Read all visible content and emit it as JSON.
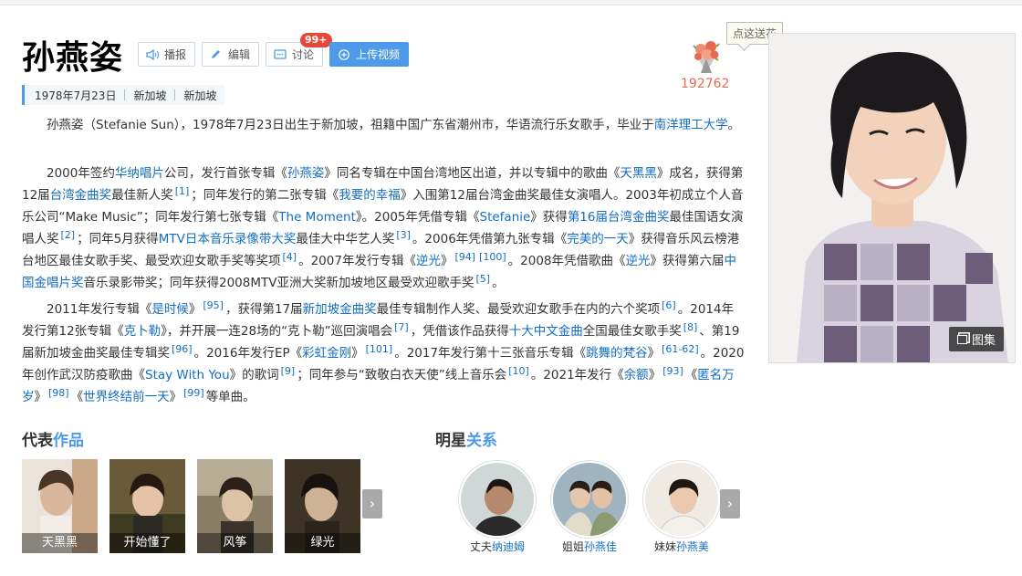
{
  "page": {
    "title": "孙燕姿",
    "actions": {
      "broadcast": "播报",
      "edit": "编辑",
      "discuss": "讨论",
      "discuss_badge": "99+",
      "upload": "上传视频"
    },
    "basic_info": [
      "1978年7月23日",
      "新加坡",
      "新加坡"
    ],
    "flower": {
      "tip": "点这送花",
      "count": "192762"
    },
    "gallery_label": "图集"
  },
  "summary": [
    [
      {
        "t": "孙燕姿（Stefanie Sun），1978年7月23日出生于新加坡，祖籍中国广东省潮州市，华语流行乐女歌手，毕业于"
      },
      {
        "a": "南洋理工大学"
      },
      {
        "t": "。"
      }
    ],
    [
      {
        "t": "2000年签约"
      },
      {
        "a": "华纳唱片"
      },
      {
        "t": "公司，发行首张专辑《"
      },
      {
        "a": "孙燕姿"
      },
      {
        "t": "》同名专辑在中国台湾地区出道，并以专辑中的歌曲《"
      },
      {
        "a": "天黑黑"
      },
      {
        "t": "》成名，获得第12届"
      },
      {
        "a": "台湾金曲奖"
      },
      {
        "t": "最佳新人奖"
      },
      {
        "s": "[1]"
      },
      {
        "t": "；同年发行的第二张专辑《"
      },
      {
        "a": "我要的幸福"
      },
      {
        "t": "》入围第12届台湾金曲奖最佳女演唱人。2003年初成立个人音乐公司“Make Music”；同年发行第七张专辑《"
      },
      {
        "a": "The Moment"
      },
      {
        "t": "》。2005年凭借专辑《"
      },
      {
        "a": "Stefanie"
      },
      {
        "t": "》获得"
      },
      {
        "a": "第16届台湾金曲奖"
      },
      {
        "t": "最佳国语女演唱人奖"
      },
      {
        "s": "[2]"
      },
      {
        "t": "；同年5月获得"
      },
      {
        "a": "MTV日本音乐录像带大奖"
      },
      {
        "t": "最佳大中华艺人奖"
      },
      {
        "s": "[3]"
      },
      {
        "t": "。2006年凭借第九张专辑《"
      },
      {
        "a": "完美的一天"
      },
      {
        "t": "》获得音乐风云榜港台地区最佳女歌手奖、最受欢迎女歌手奖等奖项"
      },
      {
        "s": "[4]"
      },
      {
        "t": "。2007年发行专辑《"
      },
      {
        "a": "逆光"
      },
      {
        "t": "》"
      },
      {
        "s": "[94]"
      },
      {
        "s": "[100]"
      },
      {
        "t": "。2008年凭借歌曲《"
      },
      {
        "a": "逆光"
      },
      {
        "t": "》获得第六届"
      },
      {
        "a": "中国金唱片奖"
      },
      {
        "t": "音乐录影带奖；同年获得2008MTV亚洲大奖新加坡地区最受欢迎歌手奖"
      },
      {
        "s": "[5]"
      },
      {
        "t": "。"
      }
    ],
    [
      {
        "t": "2011年发行专辑《"
      },
      {
        "a": "是时候"
      },
      {
        "t": "》"
      },
      {
        "s": "[95]"
      },
      {
        "t": "，获得第17届"
      },
      {
        "a": "新加坡金曲奖"
      },
      {
        "t": "最佳专辑制作人奖、最受欢迎女歌手在内的六个奖项"
      },
      {
        "s": "[6]"
      },
      {
        "t": "。2014年发行第12张专辑《"
      },
      {
        "a": "克卜勒"
      },
      {
        "t": "》，并开展一连28场的“克卜勒”巡回演唱会"
      },
      {
        "s": "[7]"
      },
      {
        "t": "，凭借该作品获得"
      },
      {
        "a": "十大中文金曲"
      },
      {
        "t": "全国最佳女歌手奖"
      },
      {
        "s": "[8]"
      },
      {
        "t": "、第19届新加坡金曲奖最佳专辑奖"
      },
      {
        "s": "[96]"
      },
      {
        "t": "。2016年发行EP《"
      },
      {
        "a": "彩虹金刚"
      },
      {
        "t": "》"
      },
      {
        "s": "[101]"
      },
      {
        "t": "。2017年发行第十三张音乐专辑《"
      },
      {
        "a": "跳舞的梵谷"
      },
      {
        "t": "》"
      },
      {
        "s": "[61-62]"
      },
      {
        "t": "。2020年创作武汉防疫歌曲《"
      },
      {
        "a": "Stay With You"
      },
      {
        "t": "》的歌词"
      },
      {
        "s": "[9]"
      },
      {
        "t": "；同年参与“致敬白衣天使”线上音乐会"
      },
      {
        "s": "[10]"
      },
      {
        "t": "。2021年发行《"
      },
      {
        "a": "余额"
      },
      {
        "t": "》"
      },
      {
        "s": "[93]"
      },
      {
        "t": "《"
      },
      {
        "a": "匿名万岁"
      },
      {
        "t": "》"
      },
      {
        "s": "[98]"
      },
      {
        "t": "《"
      },
      {
        "a": "世界终结前一天"
      },
      {
        "t": "》"
      },
      {
        "s": "[99]"
      },
      {
        "t": "等单曲。"
      }
    ]
  ],
  "works": {
    "heading_a": "代表",
    "heading_b": "作品",
    "items": [
      "天黑黑",
      "开始懂了",
      "风筝",
      "绿光"
    ]
  },
  "relations": {
    "heading_a": "明星",
    "heading_b": "关系",
    "items": [
      {
        "relation": "丈夫",
        "name": "纳迪姆"
      },
      {
        "relation": "姐姐",
        "name": "孙燕佳"
      },
      {
        "relation": "妹妹",
        "name": "孙燕美"
      }
    ]
  },
  "colors": {
    "link": "#136ec2",
    "accent": "#4c9ae8",
    "badge": "#e3483a",
    "likes": "#e36d51"
  }
}
